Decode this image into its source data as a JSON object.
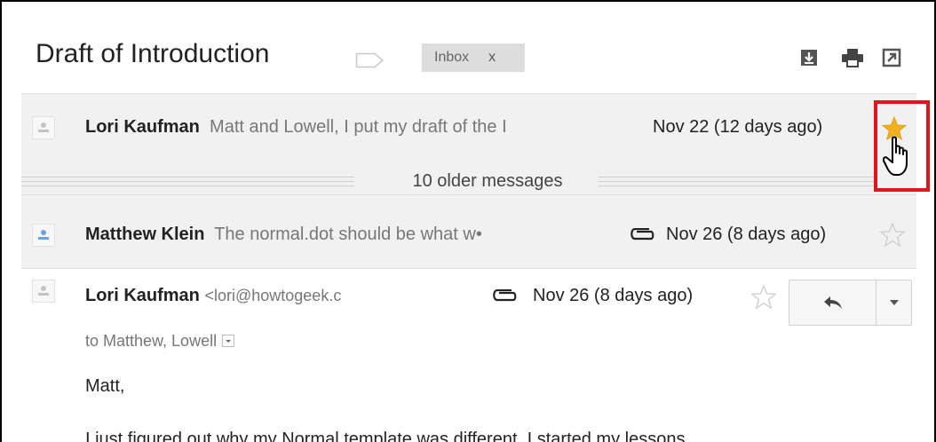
{
  "thread": {
    "subject": "Draft of Introduction",
    "label_chip": {
      "text": "Inbox",
      "remove": "x"
    }
  },
  "messages": [
    {
      "sender": "Lori Kaufman",
      "snippet": "Matt and Lowell, I put my draft of the I",
      "date": "Nov 22 (12 days ago)",
      "starred": true,
      "attachment": false
    },
    {
      "sender": "Matthew Klein",
      "snippet": "The normal.dot should be what w•",
      "date": "Nov 26 (8 days ago)",
      "starred": false,
      "attachment": true
    },
    {
      "sender": "Lori Kaufman",
      "email": "<lori@howtogeek.c",
      "date": "Nov 26 (8 days ago)",
      "starred": false,
      "attachment": true,
      "to": "to Matthew, Lowell",
      "body_greeting": "Matt,",
      "body_line": "I just figured out why my Normal template was different. I started my lessons"
    }
  ],
  "collapsed": {
    "label": "10 older messages"
  },
  "colors": {
    "highlight": "#e4141b",
    "star_filled": "#f2b01e",
    "avatar_blue": "#6aa2e6",
    "thread_band": "#f1f1f1"
  },
  "icons": [
    "label-outline-icon",
    "download-icon",
    "print-icon",
    "new-window-icon",
    "star-icon",
    "hand-cursor-icon",
    "paperclip-icon",
    "reply-icon",
    "dropdown-arrow-icon",
    "person-icon"
  ]
}
